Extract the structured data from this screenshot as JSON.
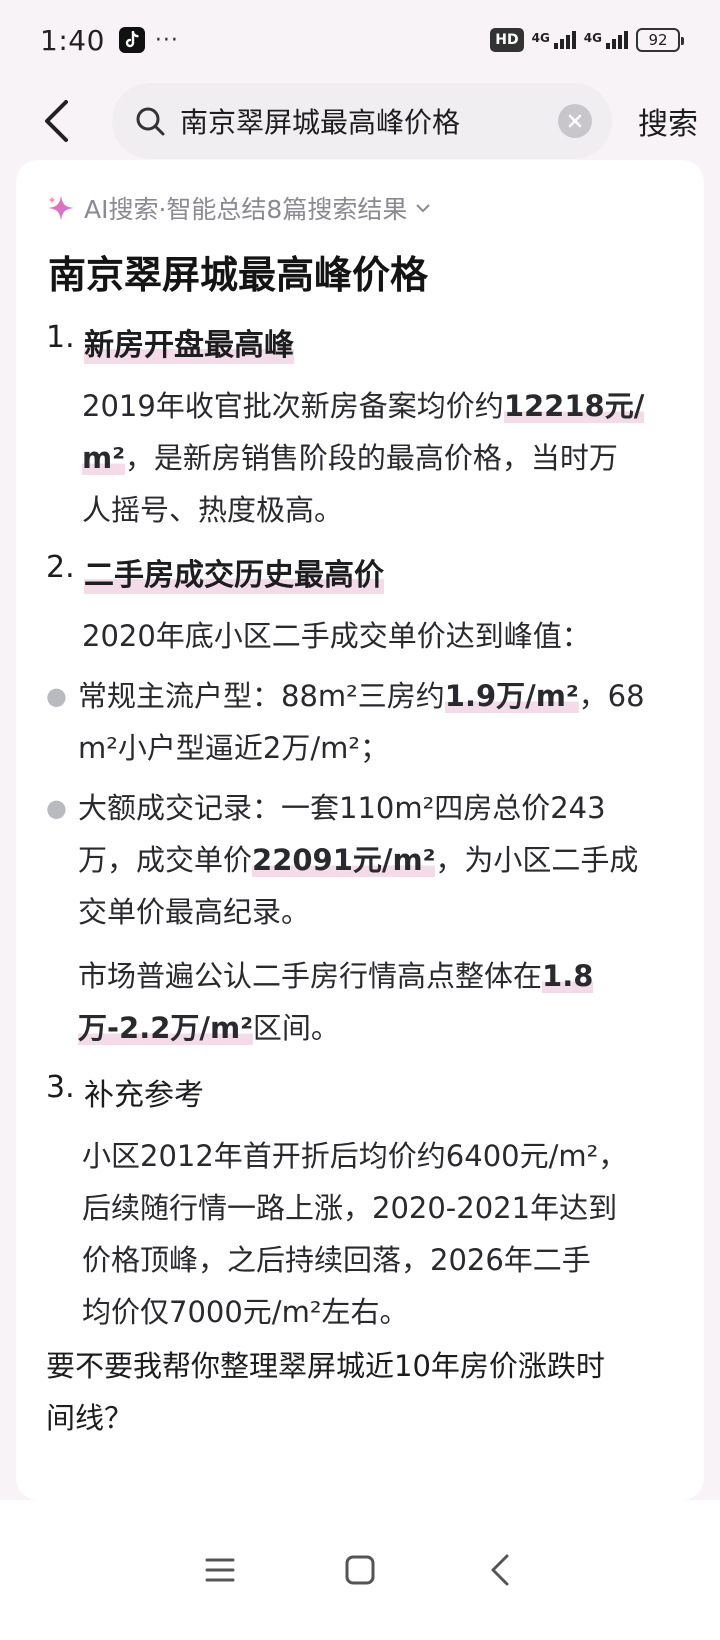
{
  "status": {
    "time": "1:40",
    "dots": "···",
    "hd": "HD",
    "net1": "4G",
    "net2": "4G",
    "battery": "92"
  },
  "search": {
    "query": "南京翠屏城最高峰价格",
    "button_label": "搜索"
  },
  "answer": {
    "ai_label": "AI搜索·智能总结8篇搜索结果",
    "title": "南京翠屏城最高峰价格",
    "s1": {
      "num": "1.",
      "heading": "新房开盘最高峰",
      "line1a": "2019年收官批次新房备案均价约",
      "line1b": "12218元/",
      "line2a": "m²",
      "line2b": "，是新房销售阶段的最高价格，当时万",
      "line3": "人摇号、热度极高。"
    },
    "s2": {
      "num": "2.",
      "heading": "二手房成交历史最高价",
      "intro": "2020年底小区二手成交单价达到峰值：",
      "b1_line1a": "常规主流户型：88m²三房约",
      "b1_line1b": "1.9万/m²",
      "b1_line1c": "，68",
      "b1_line2": "m²小户型逼近2万/m²；",
      "b2_line1": "大额成交记录：一套110m²四房总价243",
      "b2_line2a": "万，成交单价",
      "b2_line2b": "22091元/m²",
      "b2_line2c": "，为小区二手成",
      "b2_line3": "交单价最高纪录。",
      "summary_line1a": "市场普遍公认二手房行情高点整体在",
      "summary_line1b": "1.8",
      "summary_line2a": "万-2.2万/m²",
      "summary_line2b": "区间。"
    },
    "s3": {
      "num": "3.",
      "heading": "补充参考",
      "line1": "小区2012年首开折后均价约6400元/m²，",
      "line2": "后续随行情一路上涨，2020-2021年达到",
      "line3": "价格顶峰，之后持续回落，2026年二手",
      "line4": "均价仅7000元/m²左右。"
    },
    "followup_line1": "要不要我帮你整理翠屏城近10年房价涨跌时",
    "followup_line2": "间线？"
  }
}
